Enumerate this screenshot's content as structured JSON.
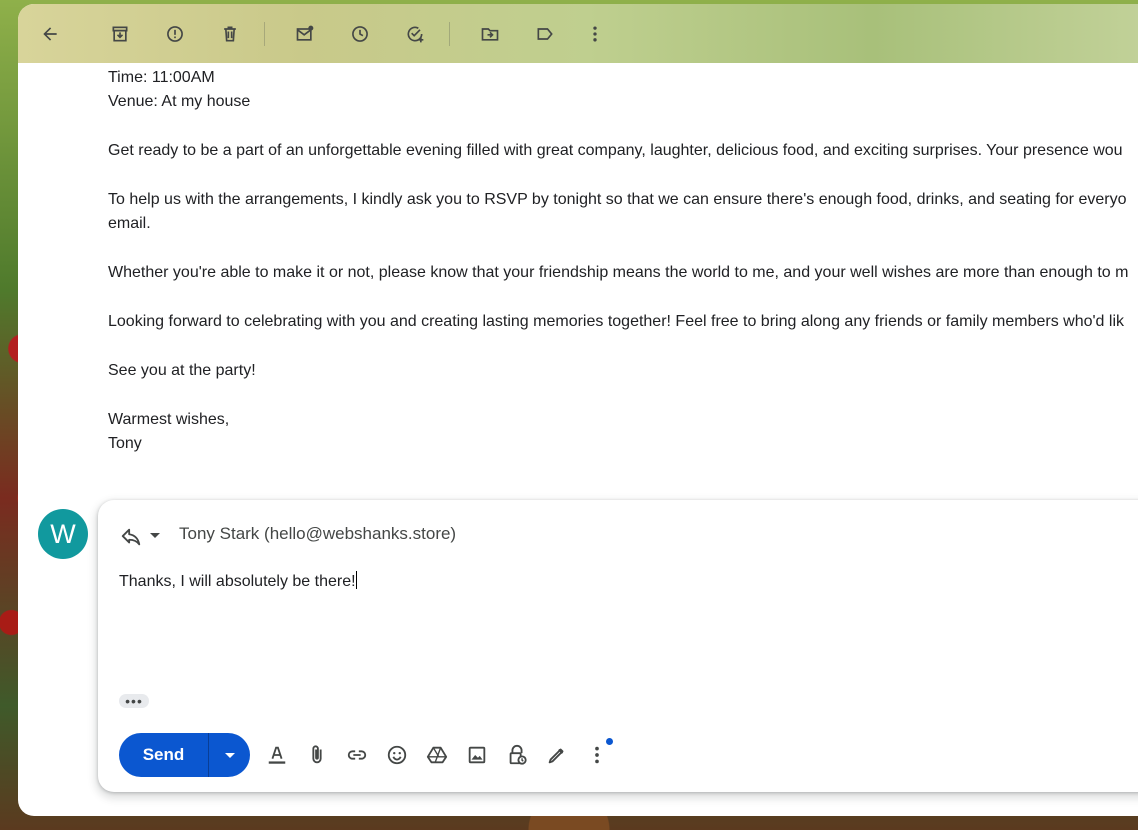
{
  "toolbar": {
    "icons": [
      "back-arrow-icon",
      "archive-icon",
      "report-spam-icon",
      "delete-icon",
      "mark-unread-icon",
      "snooze-icon",
      "add-to-tasks-icon",
      "move-to-icon",
      "label-icon",
      "more-vert-icon"
    ]
  },
  "message": {
    "time": "Time: 11:00AM",
    "venue": "Venue: At my house",
    "para1": "Get ready to be a part of an unforgettable evening filled with great company, laughter, delicious food, and exciting surprises. Your presence wou",
    "para2_line1": "To help us with the arrangements, I kindly ask you to RSVP by tonight so that we can ensure there's enough food, drinks, and seating for everyo",
    "para2_line2": "email.",
    "para3": "Whether you're able to make it or not, please know that your friendship means the world to me, and your well wishes are more than enough to m",
    "para4": "Looking forward to celebrating with you and creating lasting memories together! Feel free to bring along any friends or family members who'd lik",
    "closing1": "See you at the party!",
    "signoff": "Warmest wishes,",
    "signature": "Tony"
  },
  "reply": {
    "avatar_letter": "W",
    "avatar_color": "#11999e",
    "recipient": "Tony Stark (hello@webshanks.store)",
    "text": "Thanks, I will absolutely be there!",
    "send_label": "Send",
    "send_color": "#0b57d0",
    "format_icons": [
      "text-format-icon",
      "attach-icon",
      "link-icon",
      "emoji-icon",
      "drive-icon",
      "photo-icon",
      "confidential-mode-icon",
      "signature-icon",
      "more-options-icon"
    ]
  }
}
